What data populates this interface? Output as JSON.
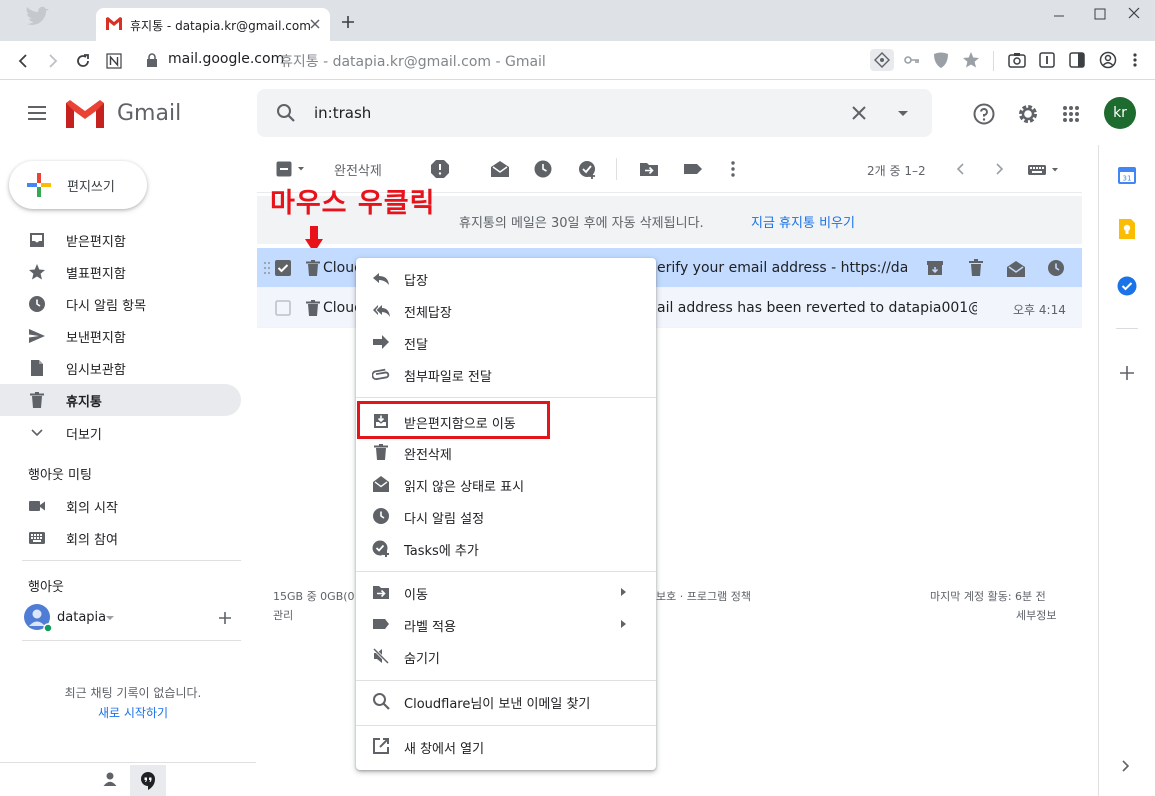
{
  "browser": {
    "tab_title": "휴지통 - datapia.kr@gmail.com",
    "url_host": "mail.google.com",
    "url_rest": "휴지통 - datapia.kr@gmail.com - Gmail",
    "new_tab": "+"
  },
  "header": {
    "app_name": "Gmail",
    "search_value": "in:trash",
    "avatar": "kr"
  },
  "sidebar": {
    "compose": "편지쓰기",
    "items": [
      {
        "label": "받은편지함",
        "icon": "inbox-icon"
      },
      {
        "label": "별표편지함",
        "icon": "star-icon"
      },
      {
        "label": "다시 알림 항목",
        "icon": "clock-icon"
      },
      {
        "label": "보낸편지함",
        "icon": "send-icon"
      },
      {
        "label": "임시보관함",
        "icon": "draft-icon"
      },
      {
        "label": "휴지통",
        "icon": "trash-icon"
      },
      {
        "label": "더보기",
        "icon": "chevron-down-icon"
      }
    ],
    "meet_title": "행아웃 미팅",
    "meet_items": [
      {
        "label": "회의 시작",
        "icon": "video-icon"
      },
      {
        "label": "회의 참여",
        "icon": "keyboard-icon"
      }
    ],
    "hangouts_title": "행아웃",
    "hangouts_user": "datapia",
    "no_chats": "최근 채팅 기록이 없습니다.",
    "start_new": "새로 시작하기"
  },
  "toolbar": {
    "delete_forever": "완전삭제",
    "pagination": "2개 중 1–2"
  },
  "banner": {
    "text": "휴지통의 메일은 30일 후에 자동 삭제됩니다.",
    "link": "지금 휴지통 비우기"
  },
  "annotation": "마우스 우클릭",
  "emails": [
    {
      "sender": "Cloud",
      "snippet": "erify your email address - https://das…",
      "time": ""
    },
    {
      "sender": "Cloud",
      "snippet": "ail address has been reverted to datapia001@g…",
      "time": "오후 4:14"
    }
  ],
  "footer": {
    "storage": "15GB 중 0GB(0",
    "manage": "관리",
    "policy": "보호 · 프로그램 정책",
    "activity": "마지막 계정 활동: 6분 전",
    "details": "세부정보"
  },
  "context_menu": {
    "items": [
      {
        "label": "답장",
        "icon": "reply-icon"
      },
      {
        "label": "전체답장",
        "icon": "reply-all-icon"
      },
      {
        "label": "전달",
        "icon": "forward-icon"
      },
      {
        "label": "첨부파일로 전달",
        "icon": "attachment-icon"
      },
      {
        "label": "받은편지함으로 이동",
        "icon": "move-to-inbox-icon"
      },
      {
        "label": "완전삭제",
        "icon": "trash-icon"
      },
      {
        "label": "읽지 않은 상태로 표시",
        "icon": "mark-unread-icon"
      },
      {
        "label": "다시 알림 설정",
        "icon": "clock-icon"
      },
      {
        "label": "Tasks에 추가",
        "icon": "add-task-icon"
      },
      {
        "label": "이동",
        "icon": "move-folder-icon"
      },
      {
        "label": "라벨 적용",
        "icon": "label-icon"
      },
      {
        "label": "숨기기",
        "icon": "mute-icon"
      },
      {
        "label": "Cloudflare님이 보낸 이메일 찾기",
        "icon": "search-icon"
      },
      {
        "label": "새 창에서 열기",
        "icon": "open-new-window-icon"
      }
    ]
  },
  "colors": {
    "selected_row": "#c2dbff",
    "highlight_box": "#e4141b",
    "link": "#1a73e8"
  }
}
